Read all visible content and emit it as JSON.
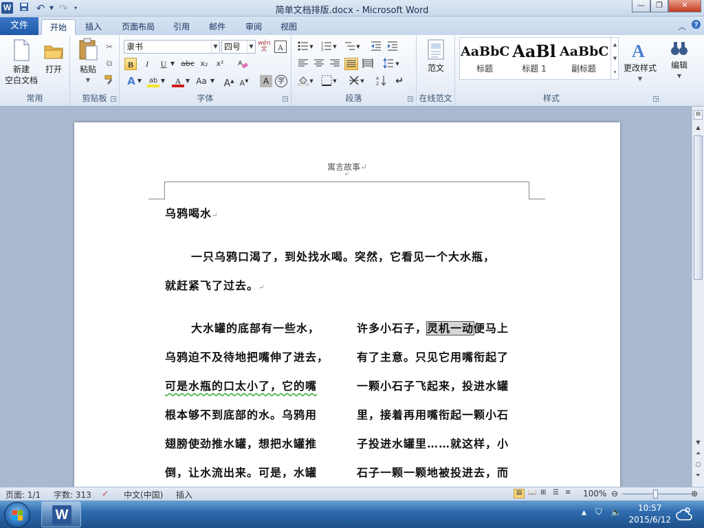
{
  "window": {
    "title": "简单文档排版.docx  -  Microsoft Word",
    "app_icon": "W",
    "qa_undo": "↶",
    "minimize": "—",
    "maximize": "❐",
    "close": "✕"
  },
  "tabs": {
    "file": "文件",
    "items": [
      "开始",
      "插入",
      "页面布局",
      "引用",
      "邮件",
      "审阅",
      "视图"
    ]
  },
  "ribbon": {
    "groups": {
      "common": "常用",
      "clipboard": "剪贴板",
      "font": "字体",
      "paragraph": "段落",
      "template_online": "在线范文",
      "styles": "样式"
    },
    "new_blank_l1": "新建",
    "new_blank_l2": "空白文档",
    "open": "打开",
    "paste": "粘贴",
    "font_name": "隶书",
    "font_size": "四号",
    "bold": "B",
    "italic": "I",
    "underline": "U",
    "strike": "abc",
    "subscript": "x₂",
    "superscript": "x²",
    "grow": "A",
    "shrink": "A",
    "case": "Aa",
    "fanwen": "范文",
    "styles": [
      {
        "preview": "AaBbC",
        "name": "标题"
      },
      {
        "preview": "AaBl",
        "name": "标题 1"
      },
      {
        "preview": "AaBbC",
        "name": "副标题"
      }
    ],
    "change_styles": "更改样式",
    "edit": "编辑"
  },
  "document": {
    "header": "寓言故事",
    "title": "乌鸦喝水",
    "p1_l1": "一只乌鸦口渴了，到处找水喝。突然，它看见一个大水瓶，",
    "p1_l2": "就赶紧飞了过去。",
    "left_col": [
      "大水罐的底部有一些水，",
      "乌鸦迫不及待地把嘴伸了进去，",
      "可是水瓶的口太小了，它的嘴",
      "根本够不到底部的水。乌鸦用",
      "翅膀使劲推水罐，想把水罐推",
      "倒，让水流出来。可是，水罐"
    ],
    "right_col_first_pre": "许多小石子，",
    "right_col_highlight": "灵机一动",
    "right_col_first_post": "便马上",
    "right_col": [
      "有了主意。只见它用嘴衔起了",
      "一颗小石子飞起来，投进水罐",
      "里，接着再用嘴衔起一颗小石",
      "子投进水罐里……就这样，小",
      "石子一颗一颗地被投进去，而"
    ]
  },
  "status": {
    "page": "页面: 1/1",
    "words": "字数: 313",
    "language": "中文(中国)",
    "mode": "插入",
    "zoom": "100%"
  },
  "taskbar": {
    "time": "10:57",
    "date": "2015/6/12"
  },
  "colors": {
    "accent": "#2b5797",
    "file_tab": "#1f5aa8"
  }
}
